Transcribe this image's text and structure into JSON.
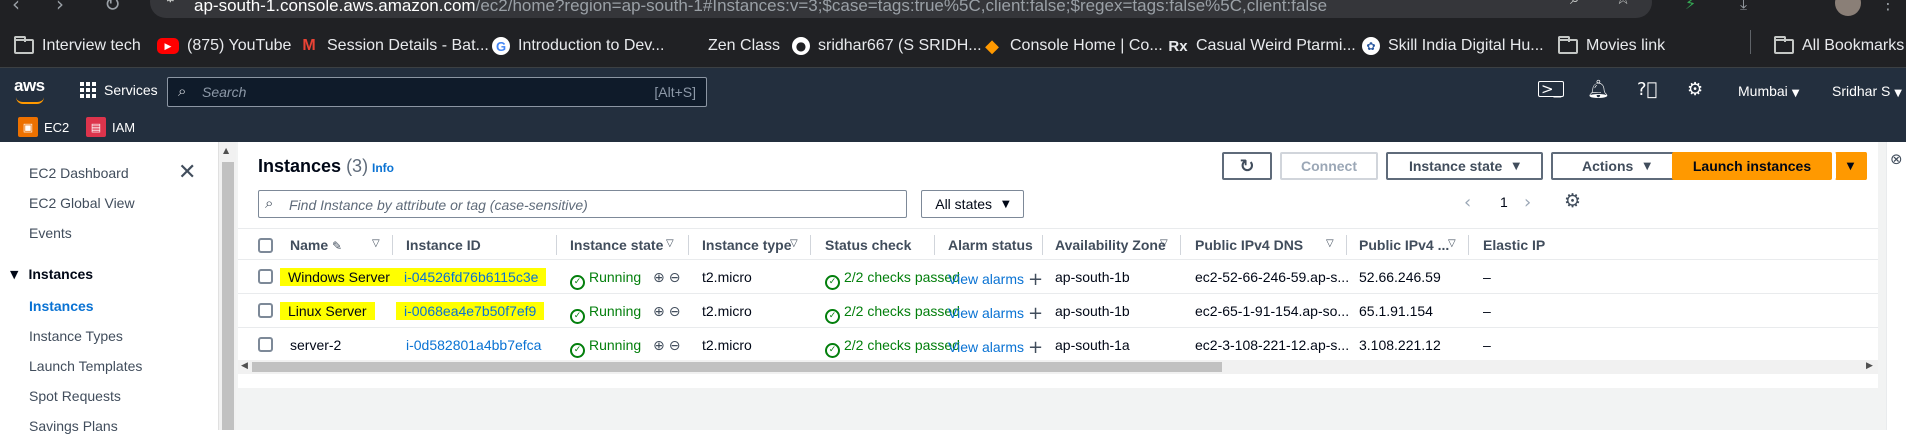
{
  "browser": {
    "url_host": "ap-south-1.console.aws.amazon.com",
    "url_rest": "/ec2/home?region=ap-south-1#Instances:v=3;$case=tags:true%5C,client:false;$regex=tags:false%5C,client:false",
    "bookmarks": [
      {
        "label": "Interview tech",
        "icon": "folder-icon"
      },
      {
        "label": "(875) YouTube",
        "icon": "youtube-icon"
      },
      {
        "label": "Session Details - Bat...",
        "icon": "gmail-icon"
      },
      {
        "label": "Introduction to Dev...",
        "icon": "google-icon"
      },
      {
        "label": "Zen Class",
        "icon": "blank-icon"
      },
      {
        "label": "sridhar667 (S SRIDH...",
        "icon": "github-icon"
      },
      {
        "label": "Console Home | Co...",
        "icon": "aws-cube-icon"
      },
      {
        "label": "Casual Weird Ptarmi...",
        "icon": "rx-icon"
      },
      {
        "label": "Skill India Digital Hu...",
        "icon": "skill-india-icon"
      },
      {
        "label": "Movies link",
        "icon": "folder-icon"
      }
    ],
    "all_bookmarks": "All Bookmarks"
  },
  "aws": {
    "logo": "aws",
    "services": "Services",
    "search_placeholder": "Search",
    "search_shortcut": "[Alt+S]",
    "region": "Mumbai",
    "user": "Sridhar S",
    "favorites": [
      {
        "label": "EC2",
        "color": "#ed7100"
      },
      {
        "label": "IAM",
        "color": "#dd344c"
      }
    ]
  },
  "sidebar": {
    "links": [
      "EC2 Dashboard",
      "EC2 Global View",
      "Events"
    ],
    "section": "Instances",
    "section_items": [
      "Instances",
      "Instance Types",
      "Launch Templates",
      "Spot Requests",
      "Savings Plans"
    ]
  },
  "main": {
    "title": "Instances",
    "count": "(3)",
    "info": "Info",
    "buttons": {
      "connect": "Connect",
      "instance_state": "Instance state",
      "actions": "Actions",
      "launch": "Launch instances"
    },
    "filter_placeholder": "Find Instance by attribute or tag (case-sensitive)",
    "states_select": "All states",
    "page": "1",
    "columns": [
      "Name",
      "Instance ID",
      "Instance state",
      "Instance type",
      "Status check",
      "Alarm status",
      "Availability Zone",
      "Public IPv4 DNS",
      "Public IPv4 ...",
      "Elastic IP"
    ],
    "rows": [
      {
        "name": "Windows Server",
        "id": "i-04526fd76b6115c3e",
        "state": "Running",
        "type": "t2.micro",
        "status": "2/2 checks passed",
        "alarm": "View alarms",
        "az": "ap-south-1b",
        "dns": "ec2-52-66-246-59.ap-s...",
        "ip": "52.66.246.59",
        "eip": "–"
      },
      {
        "name": "Linux Server",
        "id": "i-0068ea4e7b50f7ef9",
        "state": "Running",
        "type": "t2.micro",
        "status": "2/2 checks passed",
        "alarm": "View alarms",
        "az": "ap-south-1b",
        "dns": "ec2-65-1-91-154.ap-so...",
        "ip": "65.1.91.154",
        "eip": "–"
      },
      {
        "name": "server-2",
        "id": "i-0d582801a4bb7efca",
        "state": "Running",
        "type": "t2.micro",
        "status": "2/2 checks passed",
        "alarm": "View alarms",
        "az": "ap-south-1a",
        "dns": "ec2-3-108-221-12.ap-s...",
        "ip": "3.108.221.12",
        "eip": "–"
      }
    ]
  }
}
